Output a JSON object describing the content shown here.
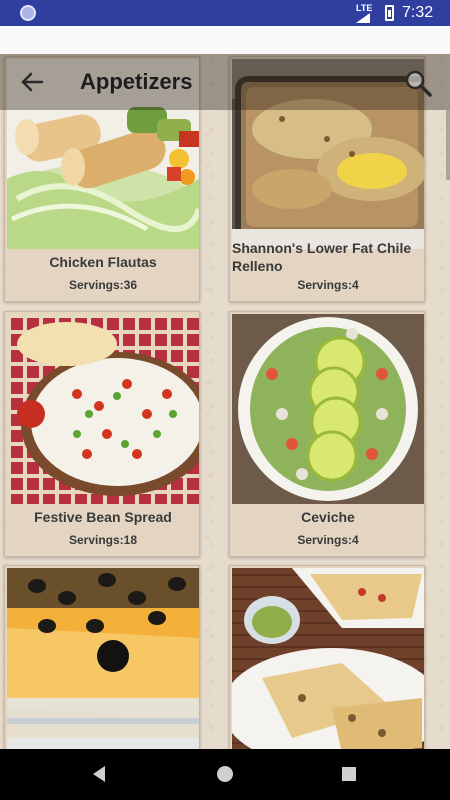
{
  "status_bar": {
    "network": "LTE",
    "time": "7:32"
  },
  "toolbar": {
    "title": "Appetizers"
  },
  "recipes": [
    {
      "name": "Chicken Flautas",
      "servings": "Servings:36"
    },
    {
      "name": "Shannon's Lower Fat Chile Relleno",
      "servings": "Servings:4"
    },
    {
      "name": "Festive Bean Spread",
      "servings": "Servings:18"
    },
    {
      "name": "Ceviche",
      "servings": "Servings:4"
    },
    {
      "name": "",
      "servings": ""
    },
    {
      "name": "",
      "servings": ""
    }
  ],
  "icons": {
    "back": "arrow-back-icon",
    "search": "search-icon",
    "nav_back": "nav-back-icon",
    "nav_home": "nav-home-icon",
    "nav_recents": "nav-recents-icon"
  },
  "colors": {
    "status_bar": "#303f9f",
    "card": "#e3d5c2",
    "background": "#e6dccd"
  }
}
